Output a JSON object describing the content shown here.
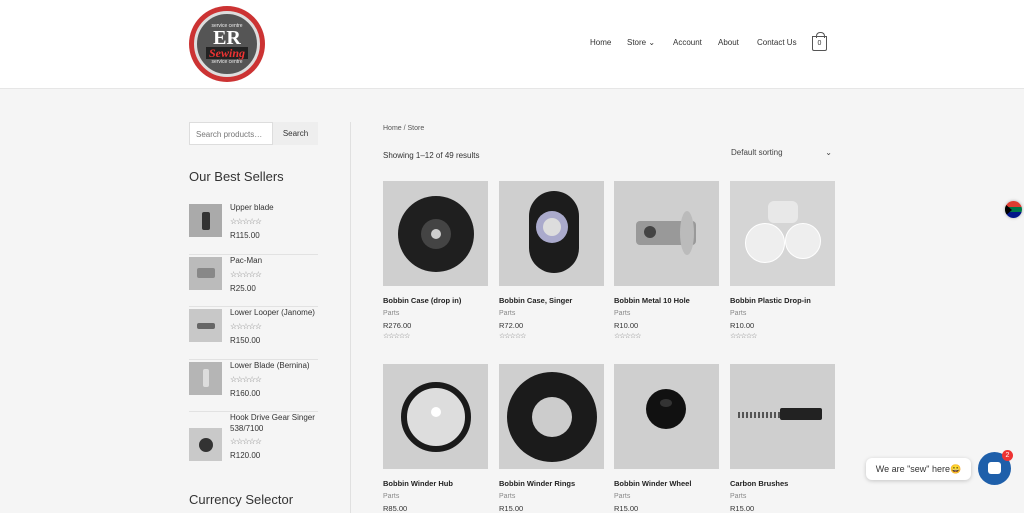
{
  "header": {
    "logo": {
      "top_text": "service centre",
      "initials": "ER",
      "script": "Sewing",
      "bottom_text": "service centre"
    },
    "nav": {
      "home": "Home",
      "store": "Store",
      "store_chevron": "⌄",
      "account": "Account",
      "about": "About",
      "contact": "Contact Us"
    },
    "cart_count": "0"
  },
  "sidebar": {
    "search_placeholder": "Search products…",
    "search_button": "Search",
    "best_sellers_title": "Our Best Sellers",
    "stars": "☆☆☆☆☆",
    "best_sellers": [
      {
        "name": "Upper blade",
        "price": "R115.00"
      },
      {
        "name": "Pac-Man",
        "price": "R25.00"
      },
      {
        "name": "Lower Looper (Janome)",
        "price": "R150.00"
      },
      {
        "name": "Lower Blade (Bernina)",
        "price": "R160.00"
      },
      {
        "name": "Hook Drive Gear Singer 538/7100",
        "price": "R120.00"
      }
    ],
    "currency_title": "Currency Selector"
  },
  "main": {
    "breadcrumb": "Home / Store",
    "result_count": "Showing 1–12 of 49 results",
    "sort_label": "Default sorting",
    "sort_chevron": "⌄",
    "stars": "☆☆☆☆☆",
    "products": [
      {
        "title": "Bobbin Case (drop in)",
        "category": "Parts",
        "price": "R276.00"
      },
      {
        "title": "Bobbin Case, Singer",
        "category": "Parts",
        "price": "R72.00"
      },
      {
        "title": "Bobbin Metal 10 Hole",
        "category": "Parts",
        "price": "R10.00"
      },
      {
        "title": "Bobbin Plastic Drop-in",
        "category": "Parts",
        "price": "R10.00"
      },
      {
        "title": "Bobbin Winder Hub",
        "category": "Parts",
        "price": "R85.00"
      },
      {
        "title": "Bobbin Winder Rings",
        "category": "Parts",
        "price": "R15.00"
      },
      {
        "title": "Bobbin Winder Wheel",
        "category": "Parts",
        "price": "R15.00"
      },
      {
        "title": "Carbon Brushes",
        "category": "Parts",
        "price": "R15.00"
      }
    ]
  },
  "chat": {
    "bubble_text": "We are \"sew\" here😀",
    "badge": "2"
  }
}
